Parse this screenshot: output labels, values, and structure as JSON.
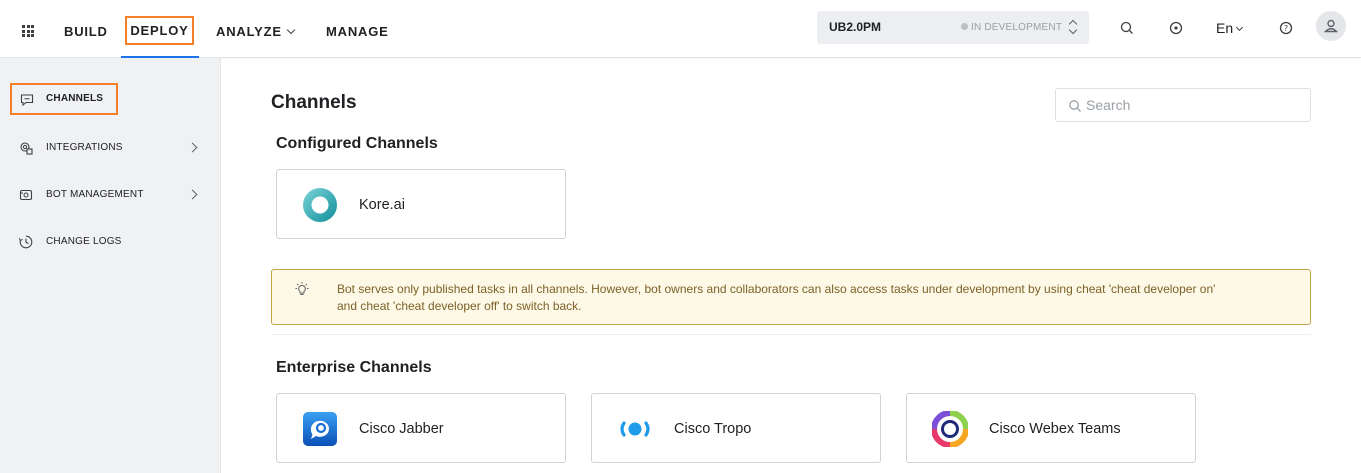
{
  "topnav": {
    "items": [
      {
        "label": "BUILD"
      },
      {
        "label": "DEPLOY"
      },
      {
        "label": "ANALYZE"
      },
      {
        "label": "MANAGE"
      }
    ],
    "active": "DEPLOY"
  },
  "bot": {
    "name": "UB2.0PM",
    "status": "IN DEVELOPMENT"
  },
  "language": "En",
  "sidebar": {
    "items": [
      {
        "label": "CHANNELS",
        "icon": "chat-icon",
        "active": true
      },
      {
        "label": "INTEGRATIONS",
        "icon": "integrations-icon",
        "has_submenu": true
      },
      {
        "label": "BOT MANAGEMENT",
        "icon": "bot-icon",
        "has_submenu": true
      },
      {
        "label": "CHANGE LOGS",
        "icon": "clock-icon"
      }
    ]
  },
  "main": {
    "title": "Channels",
    "search_placeholder": "Search",
    "configured_title": "Configured Channels",
    "configured": [
      {
        "name": "Kore.ai",
        "icon": "koreai-logo"
      }
    ],
    "note": "Bot serves only published tasks in all channels. However, bot owners and collaborators can also access tasks under development by using cheat 'cheat developer on' and cheat 'cheat developer off' to switch back.",
    "enterprise_title": "Enterprise Channels",
    "enterprise": [
      {
        "name": "Cisco Jabber",
        "icon": "cisco-jabber-logo"
      },
      {
        "name": "Cisco Tropo",
        "icon": "cisco-tropo-logo"
      },
      {
        "name": "Cisco Webex Teams",
        "icon": "cisco-webex-logo"
      }
    ]
  },
  "colors": {
    "highlight": "#f37f2a",
    "active_underline": "#1a73e8",
    "note_bg": "#fdf9e6",
    "note_border": "#c3a64a"
  }
}
